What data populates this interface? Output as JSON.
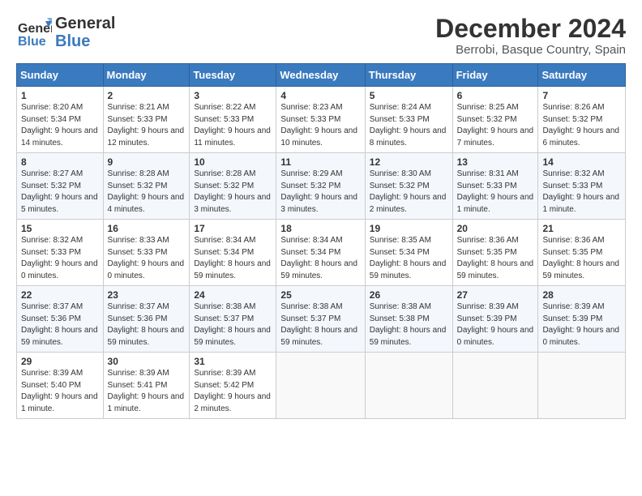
{
  "header": {
    "logo_general": "General",
    "logo_blue": "Blue",
    "month_title": "December 2024",
    "location": "Berrobi, Basque Country, Spain"
  },
  "days_of_week": [
    "Sunday",
    "Monday",
    "Tuesday",
    "Wednesday",
    "Thursday",
    "Friday",
    "Saturday"
  ],
  "weeks": [
    [
      {
        "day": "1",
        "sunrise": "Sunrise: 8:20 AM",
        "sunset": "Sunset: 5:34 PM",
        "daylight": "Daylight: 9 hours and 14 minutes."
      },
      {
        "day": "2",
        "sunrise": "Sunrise: 8:21 AM",
        "sunset": "Sunset: 5:33 PM",
        "daylight": "Daylight: 9 hours and 12 minutes."
      },
      {
        "day": "3",
        "sunrise": "Sunrise: 8:22 AM",
        "sunset": "Sunset: 5:33 PM",
        "daylight": "Daylight: 9 hours and 11 minutes."
      },
      {
        "day": "4",
        "sunrise": "Sunrise: 8:23 AM",
        "sunset": "Sunset: 5:33 PM",
        "daylight": "Daylight: 9 hours and 10 minutes."
      },
      {
        "day": "5",
        "sunrise": "Sunrise: 8:24 AM",
        "sunset": "Sunset: 5:33 PM",
        "daylight": "Daylight: 9 hours and 8 minutes."
      },
      {
        "day": "6",
        "sunrise": "Sunrise: 8:25 AM",
        "sunset": "Sunset: 5:32 PM",
        "daylight": "Daylight: 9 hours and 7 minutes."
      },
      {
        "day": "7",
        "sunrise": "Sunrise: 8:26 AM",
        "sunset": "Sunset: 5:32 PM",
        "daylight": "Daylight: 9 hours and 6 minutes."
      }
    ],
    [
      {
        "day": "8",
        "sunrise": "Sunrise: 8:27 AM",
        "sunset": "Sunset: 5:32 PM",
        "daylight": "Daylight: 9 hours and 5 minutes."
      },
      {
        "day": "9",
        "sunrise": "Sunrise: 8:28 AM",
        "sunset": "Sunset: 5:32 PM",
        "daylight": "Daylight: 9 hours and 4 minutes."
      },
      {
        "day": "10",
        "sunrise": "Sunrise: 8:28 AM",
        "sunset": "Sunset: 5:32 PM",
        "daylight": "Daylight: 9 hours and 3 minutes."
      },
      {
        "day": "11",
        "sunrise": "Sunrise: 8:29 AM",
        "sunset": "Sunset: 5:32 PM",
        "daylight": "Daylight: 9 hours and 3 minutes."
      },
      {
        "day": "12",
        "sunrise": "Sunrise: 8:30 AM",
        "sunset": "Sunset: 5:32 PM",
        "daylight": "Daylight: 9 hours and 2 minutes."
      },
      {
        "day": "13",
        "sunrise": "Sunrise: 8:31 AM",
        "sunset": "Sunset: 5:33 PM",
        "daylight": "Daylight: 9 hours and 1 minute."
      },
      {
        "day": "14",
        "sunrise": "Sunrise: 8:32 AM",
        "sunset": "Sunset: 5:33 PM",
        "daylight": "Daylight: 9 hours and 1 minute."
      }
    ],
    [
      {
        "day": "15",
        "sunrise": "Sunrise: 8:32 AM",
        "sunset": "Sunset: 5:33 PM",
        "daylight": "Daylight: 9 hours and 0 minutes."
      },
      {
        "day": "16",
        "sunrise": "Sunrise: 8:33 AM",
        "sunset": "Sunset: 5:33 PM",
        "daylight": "Daylight: 9 hours and 0 minutes."
      },
      {
        "day": "17",
        "sunrise": "Sunrise: 8:34 AM",
        "sunset": "Sunset: 5:34 PM",
        "daylight": "Daylight: 8 hours and 59 minutes."
      },
      {
        "day": "18",
        "sunrise": "Sunrise: 8:34 AM",
        "sunset": "Sunset: 5:34 PM",
        "daylight": "Daylight: 8 hours and 59 minutes."
      },
      {
        "day": "19",
        "sunrise": "Sunrise: 8:35 AM",
        "sunset": "Sunset: 5:34 PM",
        "daylight": "Daylight: 8 hours and 59 minutes."
      },
      {
        "day": "20",
        "sunrise": "Sunrise: 8:36 AM",
        "sunset": "Sunset: 5:35 PM",
        "daylight": "Daylight: 8 hours and 59 minutes."
      },
      {
        "day": "21",
        "sunrise": "Sunrise: 8:36 AM",
        "sunset": "Sunset: 5:35 PM",
        "daylight": "Daylight: 8 hours and 59 minutes."
      }
    ],
    [
      {
        "day": "22",
        "sunrise": "Sunrise: 8:37 AM",
        "sunset": "Sunset: 5:36 PM",
        "daylight": "Daylight: 8 hours and 59 minutes."
      },
      {
        "day": "23",
        "sunrise": "Sunrise: 8:37 AM",
        "sunset": "Sunset: 5:36 PM",
        "daylight": "Daylight: 8 hours and 59 minutes."
      },
      {
        "day": "24",
        "sunrise": "Sunrise: 8:38 AM",
        "sunset": "Sunset: 5:37 PM",
        "daylight": "Daylight: 8 hours and 59 minutes."
      },
      {
        "day": "25",
        "sunrise": "Sunrise: 8:38 AM",
        "sunset": "Sunset: 5:37 PM",
        "daylight": "Daylight: 8 hours and 59 minutes."
      },
      {
        "day": "26",
        "sunrise": "Sunrise: 8:38 AM",
        "sunset": "Sunset: 5:38 PM",
        "daylight": "Daylight: 8 hours and 59 minutes."
      },
      {
        "day": "27",
        "sunrise": "Sunrise: 8:39 AM",
        "sunset": "Sunset: 5:39 PM",
        "daylight": "Daylight: 9 hours and 0 minutes."
      },
      {
        "day": "28",
        "sunrise": "Sunrise: 8:39 AM",
        "sunset": "Sunset: 5:39 PM",
        "daylight": "Daylight: 9 hours and 0 minutes."
      }
    ],
    [
      {
        "day": "29",
        "sunrise": "Sunrise: 8:39 AM",
        "sunset": "Sunset: 5:40 PM",
        "daylight": "Daylight: 9 hours and 1 minute."
      },
      {
        "day": "30",
        "sunrise": "Sunrise: 8:39 AM",
        "sunset": "Sunset: 5:41 PM",
        "daylight": "Daylight: 9 hours and 1 minute."
      },
      {
        "day": "31",
        "sunrise": "Sunrise: 8:39 AM",
        "sunset": "Sunset: 5:42 PM",
        "daylight": "Daylight: 9 hours and 2 minutes."
      },
      null,
      null,
      null,
      null
    ]
  ]
}
